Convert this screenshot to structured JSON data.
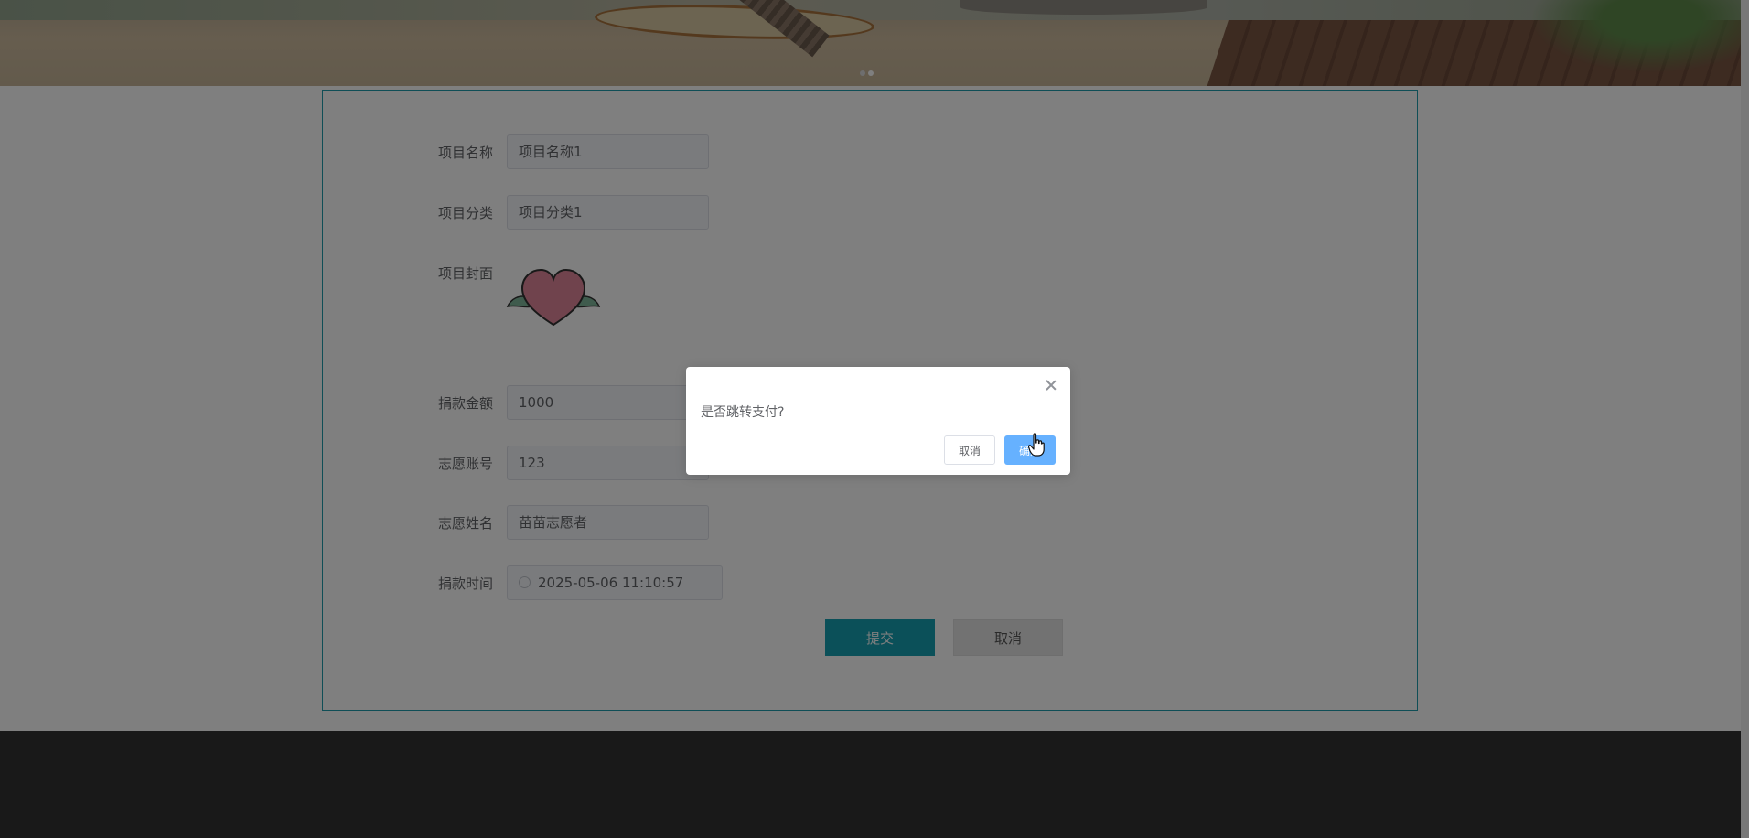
{
  "form": {
    "project_name": {
      "label": "项目名称",
      "value": "项目名称1"
    },
    "project_category": {
      "label": "项目分类",
      "value": "项目分类1"
    },
    "project_cover": {
      "label": "项目封面",
      "image_icon": "winged-heart-icon"
    },
    "donation_amount": {
      "label": "捐款金额",
      "value": "1000"
    },
    "volunteer_account": {
      "label": "志愿账号",
      "value": "123"
    },
    "volunteer_name": {
      "label": "志愿姓名",
      "value": "苗苗志愿者"
    },
    "donation_time": {
      "label": "捐款时间",
      "value": "2025-05-06 11:10:57",
      "icon": "clock-icon"
    },
    "submit_label": "提交",
    "cancel_label": "取消"
  },
  "dialog": {
    "message": "是否跳转支付?",
    "cancel_label": "取消",
    "confirm_label": "确定",
    "close_icon": "close-icon"
  },
  "colors": {
    "accent": "#16a1b3",
    "dialog_confirm": "#66b1ff",
    "footer": "#333333",
    "overlay": "rgba(0,0,0,0.5)"
  }
}
